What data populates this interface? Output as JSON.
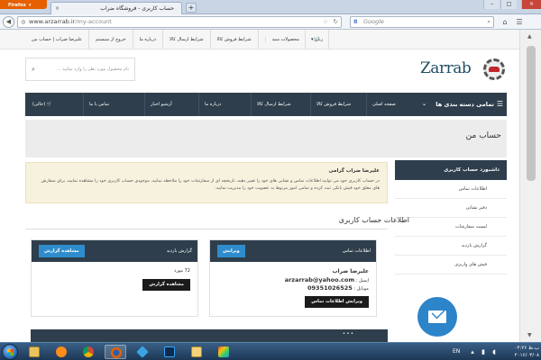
{
  "browser": {
    "menu_label": "Firefox",
    "tab_title": "حساب کاربری - فروشگاه ضراب",
    "tab_close": "×",
    "new_tab": "+",
    "url_domain": "www.arzarrab.ir",
    "url_path": "/my-account",
    "search_placeholder": "Google",
    "window_min": "–",
    "window_max": "□",
    "window_close": "×"
  },
  "site_top": {
    "language": "زبان",
    "links": [
      "علیرضا ضراب | حساب من",
      "خروج از سیستم",
      "درباره ما",
      "شرایط ارسال کالا",
      "شرایط فروش کالا",
      "محصولات سبد"
    ]
  },
  "header": {
    "search_placeholder": "نام محصول مورد نظر را وارد نمایید ...",
    "logo_text": "Zarrab"
  },
  "mainnav": {
    "categories_label": "تمامی دسته بندی ها",
    "items": [
      "صفحه اصلی",
      "شرایط فروش کالا",
      "شرایط ارسال کالا",
      "درباره ما",
      "آرشیو اخبار",
      "تماس با ما",
      "(خالی)"
    ]
  },
  "page": {
    "title": "حساب من"
  },
  "sidebar": {
    "heading": "داشبورد حساب کاربری",
    "items": [
      "اطلاعات تماس",
      "دفتر نشانی",
      "لیست سفارشات",
      "گزارش بازدید",
      "فیش های واریزی"
    ]
  },
  "welcome": {
    "greeting": "علیرضا ضراب گرامی",
    "text": "در حساب کاربری خود می توانید اطلاعات تماس و نشانی های خود را تغییر دهید، تاریخچه ای از سفارشات خود را ملاحظه نمایید، موجودی حساب کاربری خود را مشاهده نمایید، برای سفارش های معلق خود فیش بانکی ثبت کرده و تمامی امور مربوط به عضویت خود را مدیریت نمایید."
  },
  "account_section": {
    "title": "اطلاعات حساب کاربری",
    "info_card": {
      "label": "اطلاعات تماس",
      "edit_button": "ویرایش",
      "name": "علیرضا ضراب",
      "email_label": "ایمیل :",
      "email": "arzarrab@yahoo.com",
      "mobile_label": "موبایل :",
      "mobile": "09351026525",
      "edit_contact_button": "ویرایش اطلاعات تماس"
    },
    "visits_card": {
      "label": "گزارش بازدید",
      "view_button": "مشاهده گزارش",
      "count": "72 مورد",
      "view_button2": "مشاهده گزارش"
    }
  },
  "taskbar": {
    "language": "EN",
    "time": "ب.ظ ۰۴:۲۶",
    "date": "۲۰۱۶/۰۳/۰۸"
  }
}
